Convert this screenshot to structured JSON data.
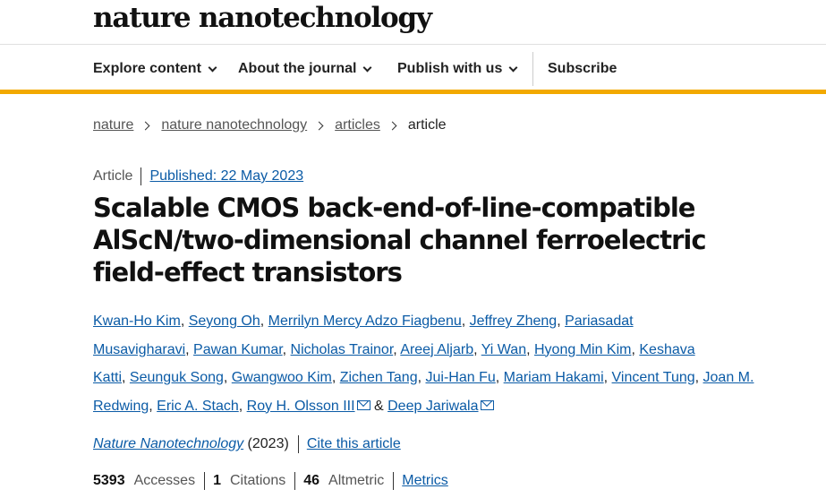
{
  "header": {
    "brand": "nature nanotechnology"
  },
  "nav": {
    "items": [
      {
        "label": "Explore content"
      },
      {
        "label": "About the journal"
      },
      {
        "label": "Publish with us"
      }
    ],
    "subscribe": "Subscribe"
  },
  "breadcrumb": [
    "nature",
    "nature nanotechnology",
    "articles",
    "article"
  ],
  "article": {
    "type": "Article",
    "published": "Published: 22 May 2023",
    "title": "Scalable CMOS back-end-of-line-compatible AlScN/two-dimensional channel ferroelectric field-effect transistors",
    "authors": [
      "Kwan-Ho Kim",
      "Seyong Oh",
      "Merrilyn Mercy Adzo Fiagbenu",
      "Jeffrey Zheng",
      "Pariasadat Musavigharavi",
      "Pawan Kumar",
      "Nicholas Trainor",
      "Areej Aljarb",
      "Yi Wan",
      "Hyong Min Kim",
      "Keshava Katti",
      "Seunguk Song",
      "Gwangwoo Kim",
      "Zichen Tang",
      "Jui-Han Fu",
      "Mariam Hakami",
      "Vincent Tung",
      "Joan M. Redwing",
      "Eric A. Stach",
      "Roy H. Olsson III",
      "Deep Jariwala"
    ],
    "author_sep": ", ",
    "author_and": " & ",
    "journal": "Nature Nanotechnology",
    "year": " (2023)",
    "cite": "Cite this article"
  },
  "metrics": {
    "accesses_value": "5393",
    "accesses_label": "Accesses",
    "citations_value": "1",
    "citations_label": "Citations",
    "altmetric_value": "46",
    "altmetric_label": "Altmetric",
    "metrics_link": "Metrics"
  },
  "icons": {
    "chevron": "chevron-down-icon",
    "breadcrumb_sep": "chevron-right-icon",
    "mail": "envelope-icon"
  }
}
